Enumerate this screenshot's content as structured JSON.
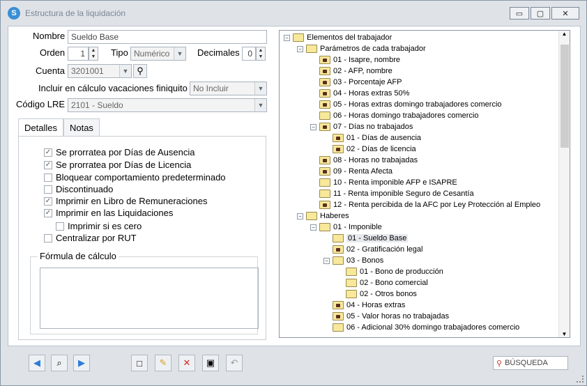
{
  "window": {
    "title": "Estructura de la liquidación",
    "buttons": [
      "▭",
      "▢",
      "✕"
    ]
  },
  "form": {
    "nombre_label": "Nombre",
    "nombre_value": "Sueldo Base",
    "orden_label": "Orden",
    "orden_value": "1",
    "tipo_label": "Tipo",
    "tipo_value": "Numérico",
    "decimales_label": "Decimales",
    "decimales_value": "0",
    "cuenta_label": "Cuenta",
    "cuenta_value": "3201001",
    "vacaciones_label": "Incluir en cálculo vacaciones finiquito",
    "vacaciones_value": "No Incluir",
    "lre_label": "Código LRE",
    "lre_value": "2101 - Sueldo"
  },
  "tabs": [
    {
      "label": "Detalles"
    },
    {
      "label": "Notas"
    }
  ],
  "checks": [
    {
      "label": "Se prorratea por Días de Ausencia",
      "checked": true
    },
    {
      "label": "Se prorratea por Días de Licencia",
      "checked": true
    },
    {
      "label": "Bloquear comportamiento predeterminado",
      "checked": false
    },
    {
      "label": "Discontinuado",
      "checked": false
    },
    {
      "label": "Imprimir en Libro de Remuneraciones",
      "checked": true
    },
    {
      "label": "Imprimir en las Liquidaciones",
      "checked": true
    },
    {
      "label": "Imprimir si es cero",
      "checked": false
    },
    {
      "label": "Centralizar por RUT",
      "checked": false
    }
  ],
  "formula": {
    "label": "Fórmula de cálculo",
    "value": ""
  },
  "tree": [
    {
      "label": "Elementos del trabajador",
      "level": 0,
      "expander": "-",
      "lock": false
    },
    {
      "label": "Parámetros de cada trabajador",
      "level": 1,
      "expander": "-",
      "lock": false
    },
    {
      "label": "01 - Isapre, nombre",
      "level": 2,
      "expander": "",
      "lock": true
    },
    {
      "label": "02 - AFP, nombre",
      "level": 2,
      "expander": "",
      "lock": true
    },
    {
      "label": "03 - Porcentaje AFP",
      "level": 2,
      "expander": "",
      "lock": true
    },
    {
      "label": "04 - Horas extras 50%",
      "level": 2,
      "expander": "",
      "lock": true
    },
    {
      "label": "05 - Horas extras domingo trabajadores comercio",
      "level": 2,
      "expander": "",
      "lock": true
    },
    {
      "label": "06 - Horas domingo trabajadores comercio",
      "level": 2,
      "expander": "",
      "lock": false
    },
    {
      "label": "07 - Días no trabajados",
      "level": 2,
      "expander": "-",
      "lock": true
    },
    {
      "label": "01 - Días de ausencia",
      "level": 3,
      "expander": "",
      "lock": true
    },
    {
      "label": "02 - Días de licencia",
      "level": 3,
      "expander": "",
      "lock": true
    },
    {
      "label": "08 - Horas no trabajadas",
      "level": 2,
      "expander": "",
      "lock": true
    },
    {
      "label": "09 - Renta Afecta",
      "level": 2,
      "expander": "",
      "lock": true
    },
    {
      "label": "10 - Renta imponible AFP e ISAPRE",
      "level": 2,
      "expander": "",
      "lock": false
    },
    {
      "label": "11 - Renta imponible Seguro de Cesantía",
      "level": 2,
      "expander": "",
      "lock": false
    },
    {
      "label": "12 - Renta percibida de la AFC por Ley Protección al Empleo",
      "level": 2,
      "expander": "",
      "lock": true
    },
    {
      "label": "Haberes",
      "level": 1,
      "expander": "-",
      "lock": false
    },
    {
      "label": "01 - Imponible",
      "level": 2,
      "expander": "-",
      "lock": false
    },
    {
      "label": "01 - Sueldo Base",
      "level": 3,
      "expander": "",
      "lock": false,
      "selected": true
    },
    {
      "label": "02 - Gratificación legal",
      "level": 3,
      "expander": "",
      "lock": true
    },
    {
      "label": "03 - Bonos",
      "level": 3,
      "expander": "-",
      "lock": false
    },
    {
      "label": "01 - Bono de producción",
      "level": 4,
      "expander": "",
      "lock": false
    },
    {
      "label": "02 - Bono comercial",
      "level": 4,
      "expander": "",
      "lock": false
    },
    {
      "label": "02 - Otros bonos",
      "level": 4,
      "expander": "",
      "lock": false
    },
    {
      "label": "04 - Horas extras",
      "level": 3,
      "expander": "",
      "lock": true
    },
    {
      "label": "05 - Valor horas no trabajadas",
      "level": 3,
      "expander": "",
      "lock": true
    },
    {
      "label": "06 - Adicional 30% domingo trabajadores comercio",
      "level": 3,
      "expander": "",
      "lock": false
    }
  ],
  "toolbar": {
    "search_label": "BÚSQUEDA"
  }
}
